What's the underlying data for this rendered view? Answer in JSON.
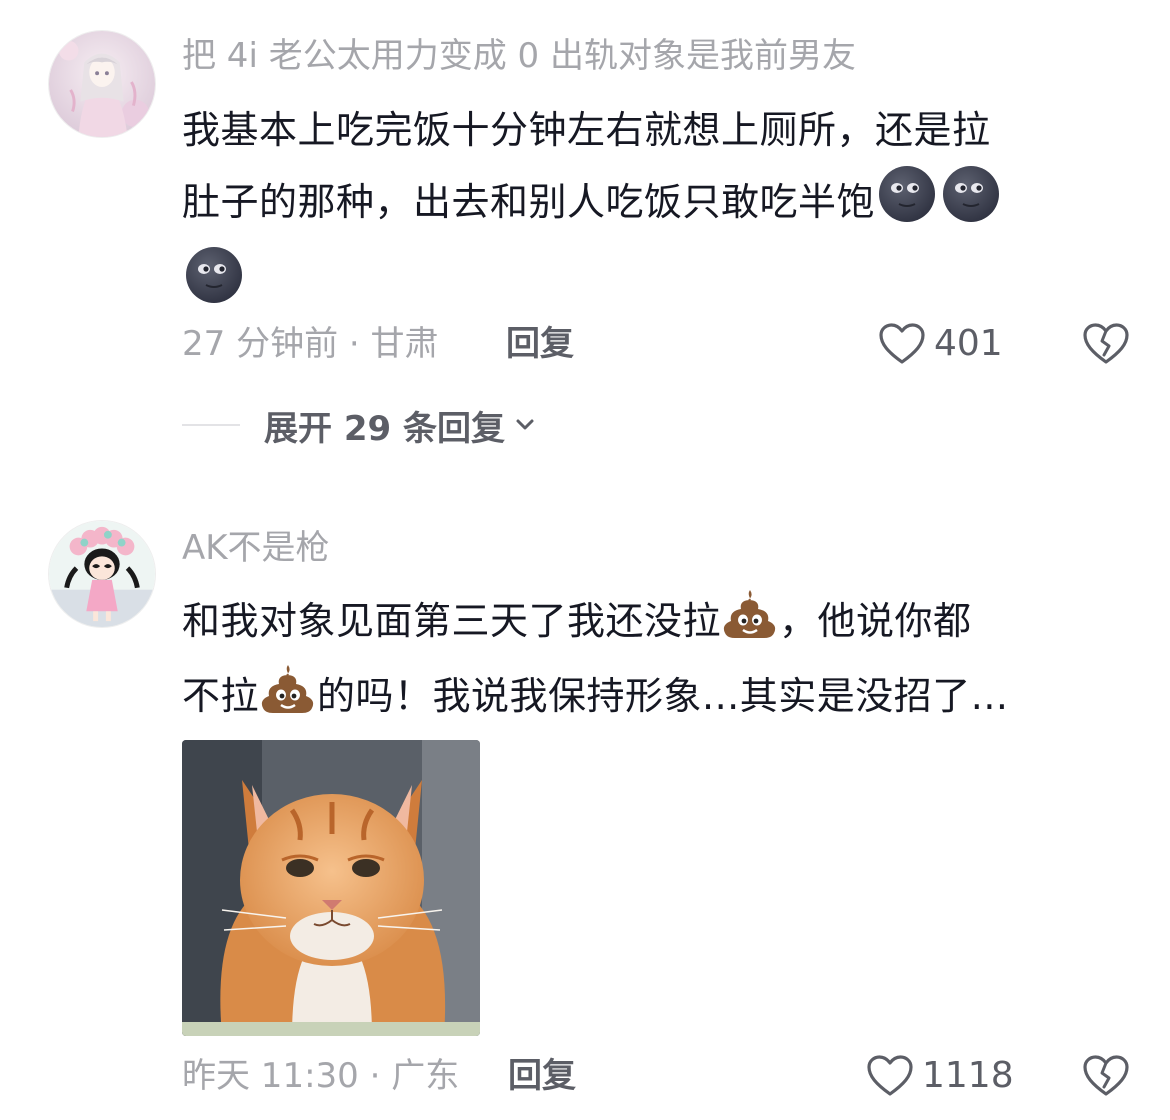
{
  "comments": [
    {
      "username": "把 4i 老公太用力变成 0 出轨对象是我前男友",
      "text_lines": [
        "我基本上吃完饭十分钟左右就想上厕所，还是拉",
        "肚子的那种，出去和别人吃饭只敢吃半饱"
      ],
      "emojis": [
        "new-moon-face",
        "new-moon-face",
        "new-moon-face"
      ],
      "time_location": "27 分钟前 · 甘肃",
      "reply_label": "回复",
      "likes": "401",
      "expand_label": "展开 29 条回复"
    },
    {
      "username": "AK不是枪",
      "text_line1": "和我对象见面第三天了我还没拉",
      "text_line1_tail": "，他说你都",
      "text_line2_head": "不拉",
      "text_line2_tail": "的吗！我说我保持形象...其实是没招了...",
      "emojis": [
        "poo-emoji",
        "poo-emoji"
      ],
      "image": "orange-cat-photo",
      "time_location": "昨天 11:30 · 广东",
      "reply_label": "回复",
      "likes": "1118"
    }
  ],
  "colors": {
    "primary_text": "#161823",
    "secondary_text": "#a5a6ab",
    "action_text": "#5c5e66"
  }
}
